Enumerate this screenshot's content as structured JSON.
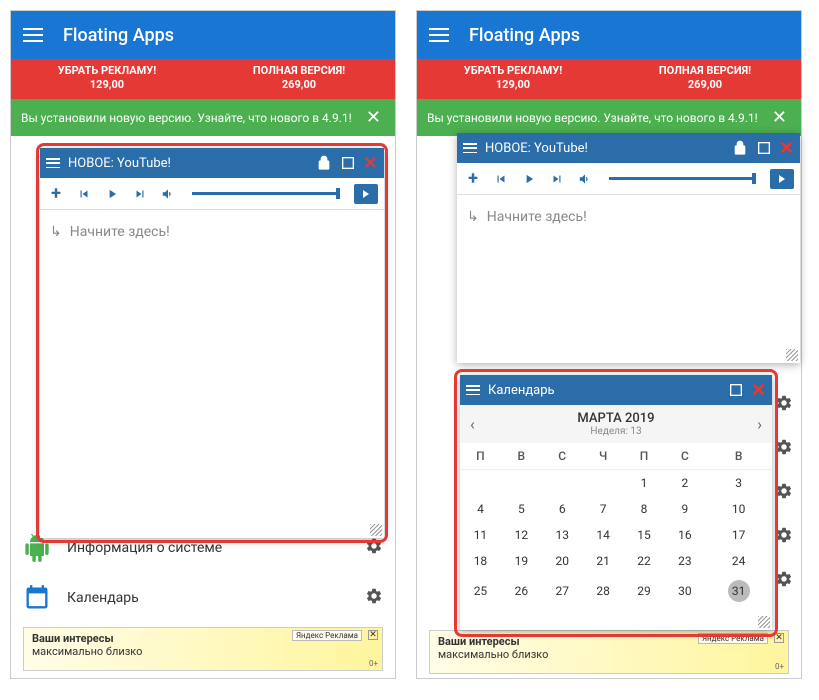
{
  "app": {
    "title": "Floating Apps"
  },
  "promo": {
    "left_title": "УБРАТЬ РЕКЛАМУ!",
    "left_price": "129,00",
    "right_title": "ПОЛНАЯ ВЕРСИЯ!",
    "right_price": "269,00"
  },
  "banner": {
    "text": "Вы установили новую версию. Узнайте, что нового в 4.9.1!"
  },
  "youtube": {
    "title": "НОВОЕ: YouTube!",
    "start": "Начните здесь!"
  },
  "calendar": {
    "title": "Календарь",
    "month": "МАРТА 2019",
    "week": "Неделя: 13",
    "days": [
      "П",
      "В",
      "С",
      "Ч",
      "П",
      "С",
      "В"
    ],
    "rows": [
      [
        "",
        "",
        "",
        "",
        "1",
        "2",
        "3"
      ],
      [
        "4",
        "5",
        "6",
        "7",
        "8",
        "9",
        "10"
      ],
      [
        "11",
        "12",
        "13",
        "14",
        "15",
        "16",
        "17"
      ],
      [
        "18",
        "19",
        "20",
        "21",
        "22",
        "23",
        "24"
      ],
      [
        "25",
        "26",
        "27",
        "28",
        "29",
        "30",
        "31"
      ]
    ],
    "today": "31"
  },
  "list": {
    "sysinfo": "Информация о системе",
    "calendar": "Календарь"
  },
  "ad": {
    "line1": "Ваши интересы",
    "line2": "максимально близко",
    "label": "Реклама",
    "brand": "Яндекс",
    "age": "0+"
  }
}
